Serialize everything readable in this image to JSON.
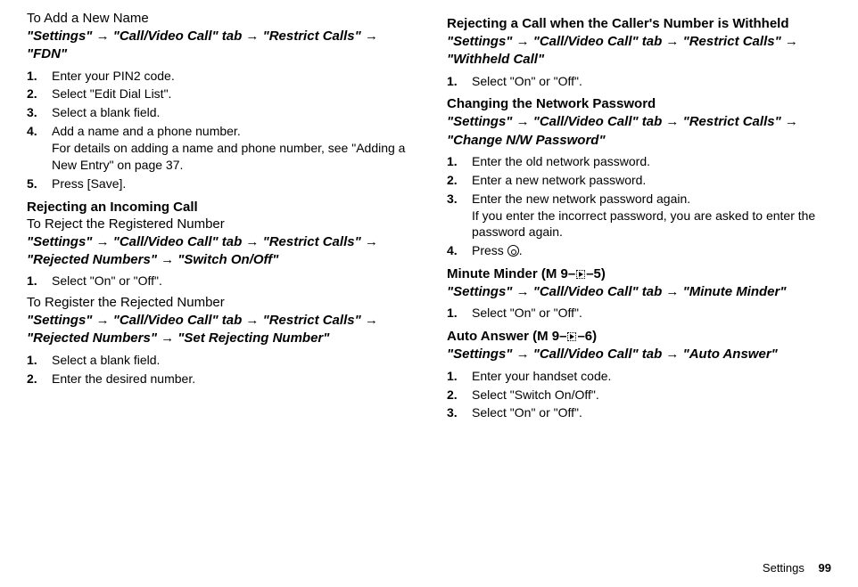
{
  "left": {
    "addName": {
      "subhead": "To Add a New Name",
      "path": "\"Settings\" → \"Call/Video Call\" tab → \"Restrict Calls\" → \"FDN\"",
      "steps": {
        "s1": "Enter your PIN2 code.",
        "s2": "Select \"Edit Dial List\".",
        "s3": "Select a blank field.",
        "s4": "Add a name and a phone number.",
        "s4note": "For details on adding a name and phone number, see \"Adding a New Entry\" on page 37.",
        "s5": "Press [Save]."
      }
    },
    "rejectIncoming": {
      "heading": "Rejecting an Incoming Call",
      "rejectRegistered": {
        "subhead": "To Reject the Registered Number",
        "path": "\"Settings\" → \"Call/Video Call\" tab → \"Restrict Calls\" → \"Rejected Numbers\" → \"Switch On/Off\"",
        "s1": "Select \"On\" or \"Off\"."
      },
      "registerRejected": {
        "subhead": "To Register the Rejected Number",
        "path": "\"Settings\" → \"Call/Video Call\" tab → \"Restrict Calls\" → \"Rejected Numbers\" → \"Set Rejecting Number\"",
        "s1": "Select a blank field.",
        "s2": "Enter the desired number."
      }
    }
  },
  "right": {
    "withheld": {
      "heading": "Rejecting a Call when the Caller's Number is Withheld",
      "path": "\"Settings\" → \"Call/Video Call\" tab → \"Restrict Calls\" → \"Withheld Call\"",
      "s1": "Select \"On\" or \"Off\"."
    },
    "changePw": {
      "heading": "Changing the Network Password",
      "path": "\"Settings\" → \"Call/Video Call\" tab → \"Restrict Calls\" → \"Change N/W Password\"",
      "s1": "Enter the old network password.",
      "s2": "Enter a new network password.",
      "s3": "Enter the new network password again.",
      "s3note": "If you enter the incorrect password, you are asked to enter the password again.",
      "s4a": "Press ",
      "s4b": "."
    },
    "minuteMinder": {
      "heading": "Minute Minder",
      "menuA": " (M 9–",
      "menuB": "–5)",
      "path": "\"Settings\" → \"Call/Video Call\" tab → \"Minute Minder\"",
      "s1": "Select \"On\" or \"Off\"."
    },
    "autoAnswer": {
      "heading": "Auto Answer",
      "menuA": " (M 9–",
      "menuB": "–6)",
      "path": "\"Settings\" → \"Call/Video Call\" tab → \"Auto Answer\"",
      "s1": "Enter your handset code.",
      "s2": "Select \"Switch On/Off\".",
      "s3": "Select \"On\" or \"Off\"."
    }
  },
  "footer": {
    "label": "Settings",
    "page": "99"
  }
}
